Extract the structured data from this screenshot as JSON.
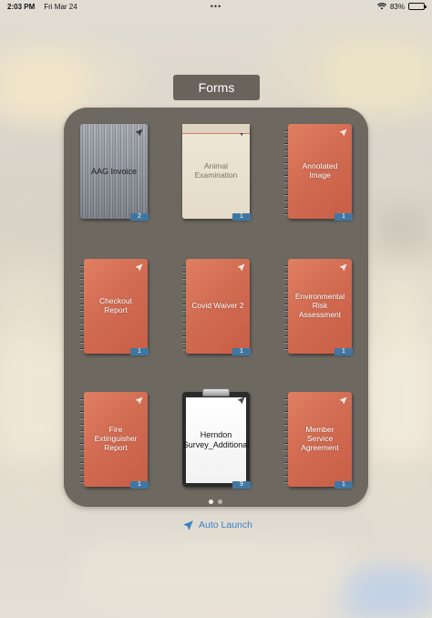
{
  "status_bar": {
    "time": "2:03 PM",
    "date": "Fri Mar 24",
    "battery_percent": "83%",
    "battery_level": 0.83
  },
  "folder": {
    "title": "Forms",
    "pages": 2,
    "active_page": 1
  },
  "forms": [
    {
      "name": "AAG  Invoice",
      "style": "metal",
      "count": "2"
    },
    {
      "name": "Animal Examination",
      "style": "paper",
      "count": "1"
    },
    {
      "name": "Annotated Image",
      "style": "notebook",
      "count": "1"
    },
    {
      "name": "Checkout Report",
      "style": "notebook",
      "count": "1"
    },
    {
      "name": "Covid Waiver 2",
      "style": "notebook",
      "count": "1"
    },
    {
      "name": "Environmental Risk Assessment",
      "style": "notebook",
      "count": "1"
    },
    {
      "name": "Fire Extinguisher Report",
      "style": "notebook",
      "count": "1"
    },
    {
      "name": "Herndon Survey_Additional",
      "style": "clipboard",
      "count": "9"
    },
    {
      "name": "Member Service Agreement",
      "style": "notebook",
      "count": "1"
    }
  ],
  "auto_launch": {
    "label": "Auto Launch",
    "icon": "location-arrow-icon"
  },
  "colors": {
    "accent": "#3a83c8",
    "badge": "#3f77a3",
    "notebook": "#d06a50",
    "panel": "#6d6860"
  }
}
